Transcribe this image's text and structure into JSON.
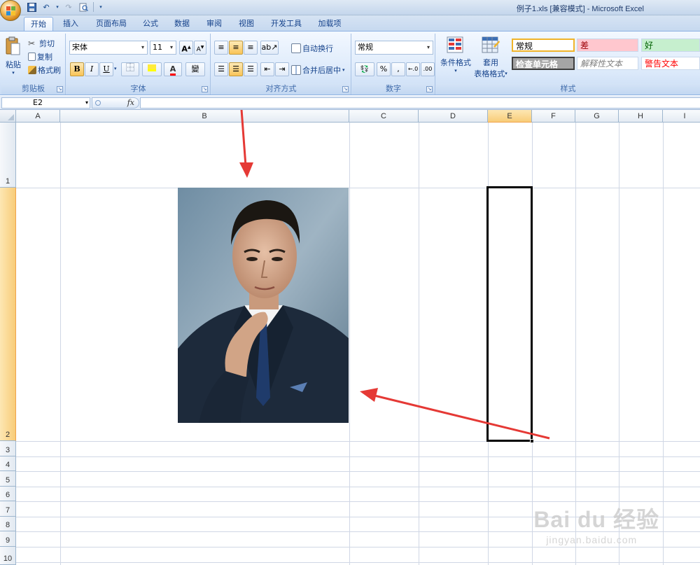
{
  "window": {
    "title": "例子1.xls  [兼容模式] - Microsoft Excel"
  },
  "tabs": [
    "开始",
    "插入",
    "页面布局",
    "公式",
    "数据",
    "审阅",
    "视图",
    "开发工具",
    "加载项"
  ],
  "active_tab": "开始",
  "ribbon": {
    "clipboard": {
      "label": "剪贴板",
      "paste": "粘贴",
      "cut": "剪切",
      "copy": "复制",
      "format_painter": "格式刷"
    },
    "font": {
      "label": "字体",
      "font_name": "宋体",
      "font_size": "11",
      "bold": "B",
      "italic": "I",
      "underline": "U",
      "phonetic": "變"
    },
    "alignment": {
      "label": "对齐方式",
      "wrap_text": "自动换行",
      "merge_center": "合并后居中"
    },
    "number": {
      "label": "数字",
      "format": "常规"
    },
    "styles": {
      "label": "样式",
      "conditional_formatting": "条件格式",
      "format_as_table_line1": "套用",
      "format_as_table_line2": "表格格式",
      "cells": [
        {
          "text": "常规",
          "bg": "#ffffff",
          "color": "#000000"
        },
        {
          "text": "差",
          "bg": "#ffc7ce",
          "color": "#9c0006"
        },
        {
          "text": "好",
          "bg": "#c6efce",
          "color": "#006100"
        },
        {
          "text": "检查单元格",
          "bg": "#a5a5a5",
          "color": "#ffffff"
        },
        {
          "text": "解释性文本",
          "bg": "#ffffff",
          "color": "#7f7f7f"
        },
        {
          "text": "警告文本",
          "bg": "#ffffff",
          "color": "#ff0000"
        }
      ]
    }
  },
  "formula_bar": {
    "name_box": "E2",
    "fx": "fx",
    "content": ""
  },
  "sheet": {
    "columns": [
      "A",
      "B",
      "C",
      "D",
      "E",
      "F",
      "G",
      "H",
      "I"
    ],
    "rows": [
      "1",
      "2",
      "3",
      "4",
      "5",
      "6",
      "7",
      "8",
      "9",
      "10"
    ],
    "selected_cell": "E2",
    "selected_column": "E",
    "selected_row": "2"
  },
  "annotations": {
    "arrow_color": "#e53935"
  },
  "watermark": {
    "main": "Bai du 经验",
    "sub": "jingyan.baidu.com"
  }
}
